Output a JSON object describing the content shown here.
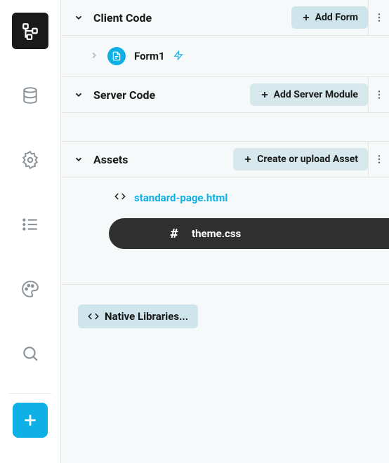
{
  "sections": {
    "client": {
      "title": "Client Code",
      "addLabel": "Add Form"
    },
    "server": {
      "title": "Server Code",
      "addLabel": "Add Server Module"
    },
    "assets": {
      "title": "Assets",
      "addLabel": "Create or upload Asset"
    }
  },
  "clientItems": {
    "form1": "Form1"
  },
  "assetItems": {
    "html": "standard-page.html",
    "css": "theme.css"
  },
  "buttons": {
    "nativeLibraries": "Native Libraries..."
  }
}
